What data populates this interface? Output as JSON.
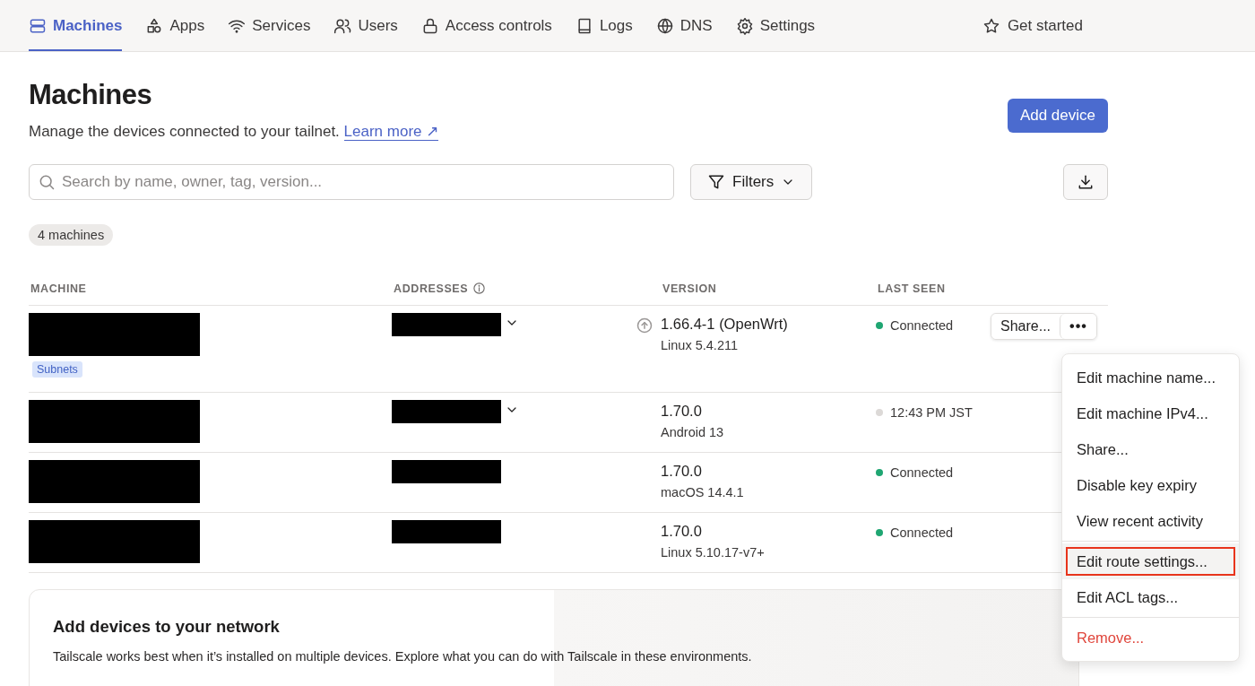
{
  "nav": {
    "tabs": [
      {
        "label": "Machines",
        "selected": true
      },
      {
        "label": "Apps",
        "selected": false
      },
      {
        "label": "Services",
        "selected": false
      },
      {
        "label": "Users",
        "selected": false
      },
      {
        "label": "Access controls",
        "selected": false
      },
      {
        "label": "Logs",
        "selected": false
      },
      {
        "label": "DNS",
        "selected": false
      },
      {
        "label": "Settings",
        "selected": false
      }
    ],
    "get_started": "Get started"
  },
  "page": {
    "title": "Machines",
    "description": "Manage the devices connected to your tailnet.",
    "learn_more": "Learn more ↗",
    "add_button": "Add device"
  },
  "search": {
    "placeholder": "Search by name, owner, tag, version..."
  },
  "filters_button": "Filters",
  "count_badge": "4 machines",
  "table": {
    "columns": [
      "MACHINE",
      "ADDRESSES",
      "VERSION",
      "LAST SEEN"
    ],
    "rows": [
      {
        "tags": [
          "Subnets"
        ],
        "address_expandable": true,
        "update_available": true,
        "version": "1.66.4-1 (OpenWrt)",
        "os": "Linux 5.4.211",
        "connected": true,
        "last_seen": "Connected",
        "actions": {
          "share": "Share...",
          "more": "•••"
        }
      },
      {
        "tags": [],
        "address_expandable": true,
        "update_available": false,
        "version": "1.70.0",
        "os": "Android 13",
        "connected": false,
        "last_seen": "12:43 PM JST"
      },
      {
        "tags": [],
        "address_expandable": false,
        "update_available": false,
        "version": "1.70.0",
        "os": "macOS 14.4.1",
        "connected": true,
        "last_seen": "Connected"
      },
      {
        "tags": [],
        "address_expandable": false,
        "update_available": false,
        "version": "1.70.0",
        "os": "Linux 5.10.17-v7+",
        "connected": true,
        "last_seen": "Connected"
      }
    ]
  },
  "menu": {
    "groups": [
      [
        {
          "label": "Edit machine name...",
          "kind": "normal",
          "highlighted": false
        },
        {
          "label": "Edit machine IPv4...",
          "kind": "normal",
          "highlighted": false
        },
        {
          "label": "Share...",
          "kind": "normal",
          "highlighted": false
        },
        {
          "label": "Disable key expiry",
          "kind": "normal",
          "highlighted": false
        },
        {
          "label": "View recent activity",
          "kind": "normal",
          "highlighted": false
        }
      ],
      [
        {
          "label": "Edit route settings...",
          "kind": "normal",
          "highlighted": true
        },
        {
          "label": "Edit ACL tags...",
          "kind": "normal",
          "highlighted": false
        }
      ],
      [
        {
          "label": "Remove...",
          "kind": "danger",
          "highlighted": false
        }
      ]
    ]
  },
  "promo": {
    "title": "Add devices to your network",
    "text": "Tailscale works best when it’s installed on multiple devices. Explore what you can do with Tailscale in these environments."
  }
}
